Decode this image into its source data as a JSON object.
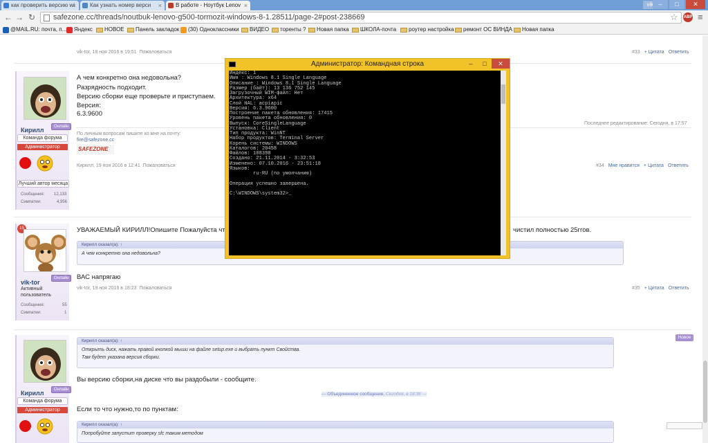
{
  "browser": {
    "tabs": [
      {
        "label": "как проверить версию wi"
      },
      {
        "label": "Как узнать номер верси"
      },
      {
        "label": "В работе - Ноутбук Lenov"
      }
    ],
    "user": "viktor",
    "url": "safezone.cc/threads/noutbuk-lenovo-g500-tormozit-windows-8-1.28511/page-2#post-238669",
    "bookmarks": [
      "@MAIL.RU: почта, п...",
      "Яндекс",
      "НОВОЕ",
      "Панель закладок",
      "(30) Одноклассники",
      "ВИДЕО",
      "торенты ?",
      "Новая папка",
      "ШКОЛА-почта",
      "роутер настройка",
      "ремонт ОС ВИНДА",
      "Новая папка"
    ],
    "abp_label": "ABP"
  },
  "post33": {
    "author_date": "vik-tor, 18 ноя 2016 в 19:51",
    "report": "Пожаловаться",
    "num": "#33",
    "quote": "+ Цитата",
    "reply": "Ответить"
  },
  "post34": {
    "lines": [
      "А чем конкретно она недовольна?",
      "Разрядность подходит.",
      "Версию сборки еще проверьте и приступаем.",
      "Версия:",
      "6.3.9600"
    ],
    "edited": "Последнее редактирование: Сегодня, в 17:57",
    "signature": "По личным вопросам пишите ко мне на почту:",
    "email": "fire@safezone.cc",
    "logo": "SAFEZONE",
    "user": {
      "name": "Кирилл",
      "online": "Онлайн",
      "role": "Команда форума",
      "rank": "Администратор",
      "award": "Лучший автор месяца",
      "messages_label": "Сообщения:",
      "messages": "12,133",
      "likes_label": "Симпатии:",
      "likes": "4,956"
    },
    "author_date": "Кирилл, 19 ноя 2016 в 12:41",
    "report": "Пожаловаться",
    "num": "#34",
    "like": "Мне нравится",
    "quote": "+ Цитата",
    "reply": "Ответить"
  },
  "post35": {
    "text_left": "УВАЖАЕМЫЙ КИРИЛЛ!Опишите Пожалуйста что и к",
    "text_right": "чистил полностью 25ггов.",
    "quote_header": "Кирилл сказал(а): ↑",
    "quote_body": "А чем конкретно она недовольна?",
    "reply": "ВАС напрягаю",
    "badge": "15",
    "user": {
      "name": "vik-tor",
      "online": "Онлайн",
      "title1": "Активный",
      "title2": "пользователь",
      "messages_label": "Сообщения:",
      "messages": "55",
      "likes_label": "Симпатии:",
      "likes": "1"
    },
    "author_date": "vik-tor, 19 ноя 2016 в 18:23",
    "report": "Пожаловаться",
    "num": "#35",
    "quote": "+ Цитата",
    "reply_btn": "Ответить"
  },
  "post36": {
    "new": "Новое",
    "quote_header": "Кирилл сказал(а): ↑",
    "quote_lines": [
      "Открыть диск, нажать правой кнопкой мыши на файле setup.exe и выбрать пункт Свойства.",
      "Там будет указана версия сборки."
    ],
    "text1": "Вы версию сборки,на диске что вы раздобыли - сообщите.",
    "merged": "--- Объединенное сообщение,",
    "merged_date": "Сегодня, в 18:36 ---",
    "text2": "Если то что нужно,то по пунктам:",
    "quote2_header": "Кирилл сказал(а): ↑",
    "quote2_body": "Попробуйте запустит проверку sfc   таким методом",
    "user": {
      "name": "Кирилл",
      "online": "Онлайн",
      "role": "Команда форума",
      "rank": "Администратор"
    }
  },
  "cmd": {
    "title": "Администратор: Командная строка",
    "lines": [
      "Индекс: 1",
      "Имя : Windows 8.1 Single Language",
      "Описание : Windows 8.1 Single Language",
      "Размер (байт): 13 136 752 145",
      "Загрузочный WIM-файл: Нет",
      "Архитектура: x64",
      "Слой HAL: acpiapic",
      "Версия: 6.3.9600",
      "Построение пакета обновления: 17415",
      "Уровень пакета обновления: 0",
      "Выпуск: CoreSingleLanguage",
      "Установка: Client",
      "Тип продукта: WinNT",
      "Набор продуктов: Terminal Server",
      "Корень системы: WINDOWS",
      "Каталогов: 20458",
      "Файлов: 108398",
      "Создано: 21.11.2014 - 3:32:53",
      "Изменено: 07.10.2016 - 23:51:18",
      "Языков:",
      "        ru-RU (по умолчанию)",
      "",
      "Операция успешно завершена.",
      "",
      "C:\\WINDOWS\\system32>_"
    ]
  }
}
